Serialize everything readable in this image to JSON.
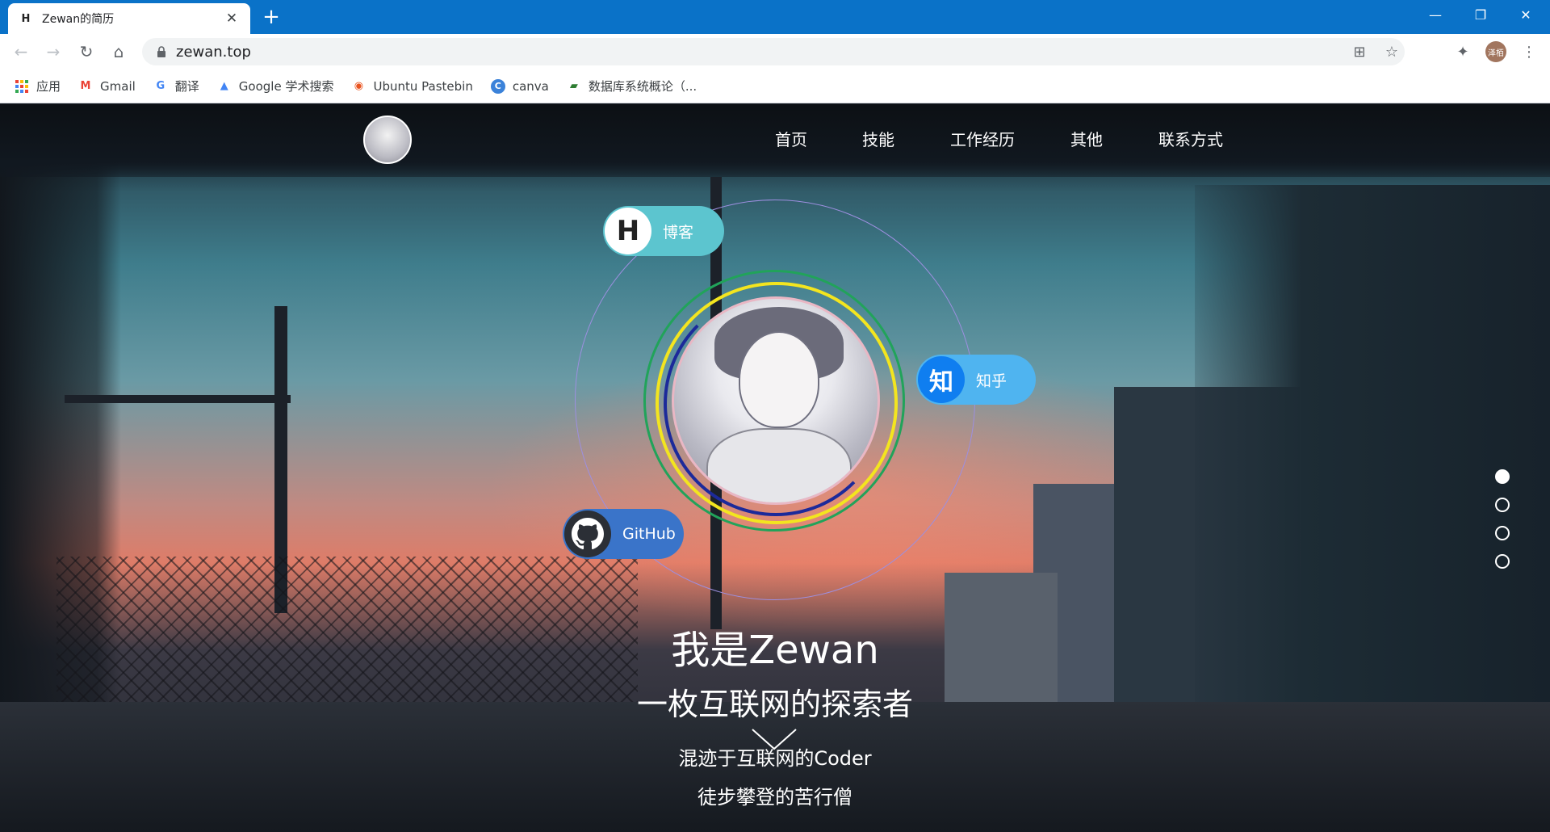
{
  "browser": {
    "tab_title": "Zewan的简历",
    "tab_favicon": "H",
    "url": "zewan.top",
    "profile_label": "泽栢",
    "icons": [
      "back-icon",
      "forward-icon",
      "reload-icon",
      "home-icon",
      "lock-icon",
      "translate-icon",
      "star-icon",
      "extensions-icon",
      "more-icon"
    ]
  },
  "bookmarks": [
    {
      "label": "应用",
      "icon": "apps-grid-icon"
    },
    {
      "label": "Gmail",
      "icon": "gmail-icon"
    },
    {
      "label": "翻译",
      "icon": "translate-icon"
    },
    {
      "label": "Google 学术搜索",
      "icon": "scholar-icon"
    },
    {
      "label": "Ubuntu Pastebin",
      "icon": "ubuntu-icon"
    },
    {
      "label": "canva",
      "icon": "canva-icon"
    },
    {
      "label": "数据库系统概论（...",
      "icon": "book-icon"
    }
  ],
  "site": {
    "nav": [
      "首页",
      "技能",
      "工作经历",
      "其他",
      "联系方式"
    ],
    "social": {
      "blog": {
        "label": "博客",
        "icon_text": "H"
      },
      "zhihu": {
        "label": "知乎",
        "icon_text": "知"
      },
      "github": {
        "label": "GitHub"
      }
    },
    "hero": {
      "name": "我是Zewan",
      "tagline": "一枚互联网的探索者",
      "line1": "混迹于互联网的Coder",
      "line2": "徒步攀登的苦行僧"
    },
    "section_dots": 4,
    "active_dot": 0
  },
  "colors": {
    "chrome_blue": "#0a72c8",
    "blog_pill": "#5cc5cf",
    "zhihu_pill": "#4fb4f0",
    "github_pill": "#3a74c9"
  }
}
